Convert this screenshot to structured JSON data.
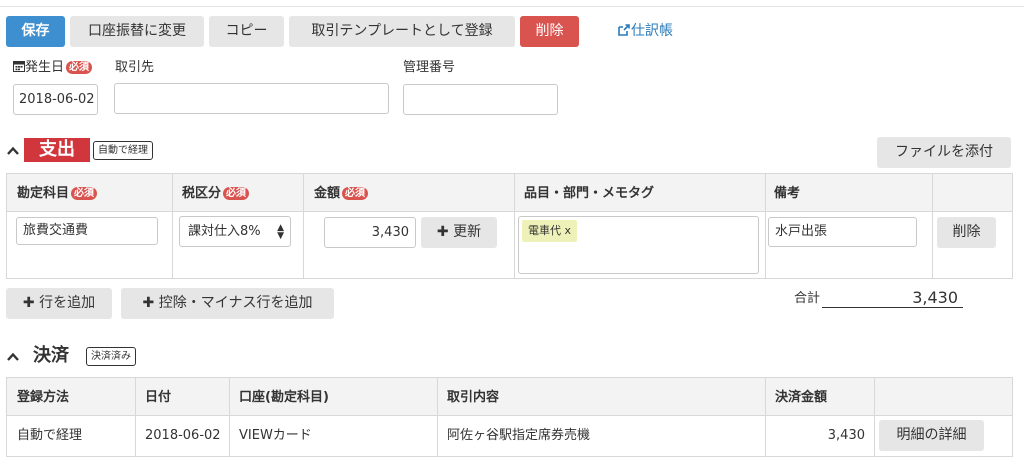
{
  "toolbar": {
    "save": "保存",
    "transfer": "口座振替に変更",
    "copy": "コピー",
    "template": "取引テンプレートとして登録",
    "delete": "削除",
    "journal_link": "仕訳帳"
  },
  "header_fields": {
    "date_label": "発生日",
    "required": "必須",
    "date_value": "2018-06-02",
    "partner_label": "取引先",
    "partner_value": "",
    "mgmt_label": "管理番号",
    "mgmt_value": ""
  },
  "expense": {
    "title": "支出",
    "auto_badge": "自動で経理",
    "attach_button": "ファイルを添付",
    "columns": [
      "勘定科目",
      "税区分",
      "金額",
      "品目・部門・メモタグ",
      "備考"
    ],
    "required": "必須",
    "row": {
      "account": "旅費交通費",
      "tax": "課対仕入8%",
      "amount": "3,430",
      "update_button": "更新",
      "tag": "電車代 x",
      "memo": "水戸出張",
      "delete_button": "削除"
    },
    "add_row_button": "行を追加",
    "add_deduction_button": "控除・マイナス行を追加",
    "total_label": "合計",
    "total_value": "3,430"
  },
  "settlement": {
    "title": "決済",
    "status_badge": "決済済み",
    "columns": [
      "登録方法",
      "日付",
      "口座(勘定科目)",
      "取引内容",
      "決済金額"
    ],
    "row": {
      "method": "自動で経理",
      "date": "2018-06-02",
      "account": "VIEWカード",
      "description": "阿佐ヶ谷駅指定席券売機",
      "amount": "3,430",
      "detail_button": "明細の詳細"
    }
  },
  "colors": {
    "save_blue": "#3d8fcf",
    "delete_red": "#d9534f",
    "expense_red": "#d1363d",
    "link_blue": "#2a7ab8",
    "tag_yellow": "#eef2b8"
  }
}
